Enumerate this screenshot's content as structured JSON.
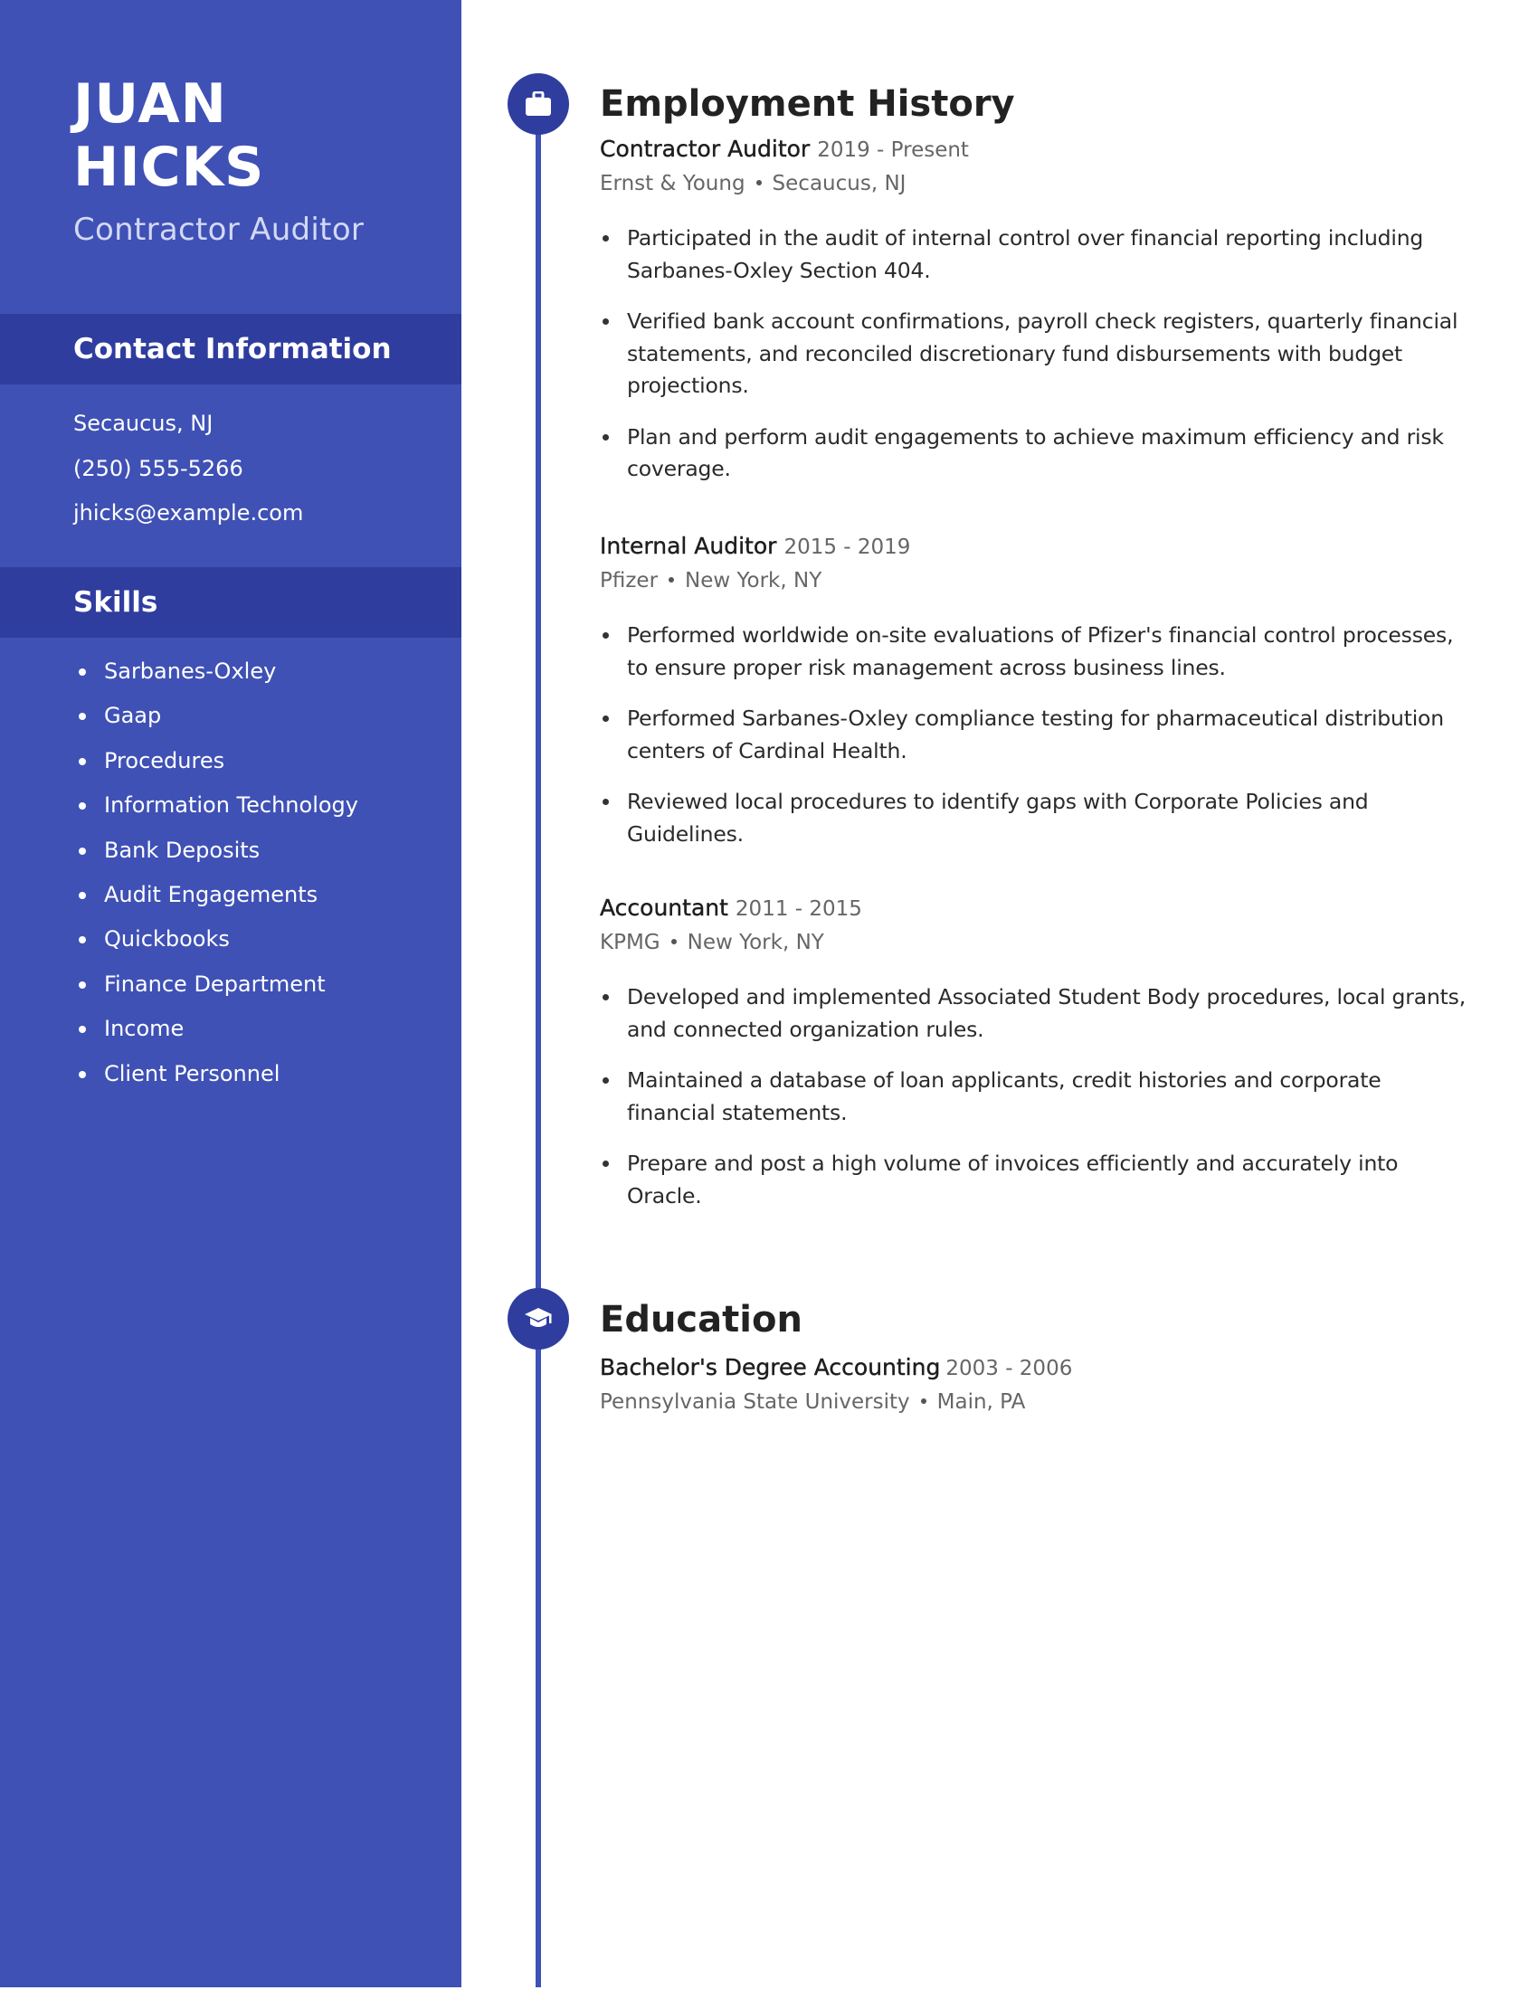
{
  "profile": {
    "first_name": "JUAN",
    "last_name": "HICKS",
    "headline": "Contractor Auditor"
  },
  "sidebar": {
    "contact": {
      "heading": "Contact Information",
      "location": "Secaucus, NJ",
      "phone": "(250) 555-5266",
      "email": "jhicks@example.com"
    },
    "skills": {
      "heading": "Skills",
      "items": [
        "Sarbanes-Oxley",
        "Gaap",
        "Procedures",
        "Information Technology",
        "Bank Deposits",
        "Audit Engagements",
        "Quickbooks",
        "Finance Department",
        "Income",
        "Client Personnel"
      ]
    }
  },
  "employment": {
    "heading": "Employment History",
    "icon": "briefcase-icon",
    "jobs": [
      {
        "title": "Contractor Auditor",
        "dates": "2019 - Present",
        "company": "Ernst & Young",
        "location": "Secaucus, NJ",
        "bullets": [
          "Participated in the audit of internal control over financial reporting including Sarbanes-Oxley Section 404.",
          "Verified bank account confirmations, payroll check registers, quarterly financial statements, and reconciled discretionary fund disbursements with budget projections.",
          "Plan and perform audit engagements to achieve maximum efficiency and risk coverage."
        ]
      },
      {
        "title": "Internal Auditor",
        "dates": "2015 - 2019",
        "company": "Pfizer",
        "location": "New York, NY",
        "bullets": [
          "Performed worldwide on-site evaluations of Pfizer's financial control processes, to ensure proper risk management across business lines.",
          "Performed Sarbanes-Oxley compliance testing for pharmaceutical distribution centers of Cardinal Health.",
          "Reviewed local procedures to identify gaps with Corporate Policies and Guidelines."
        ]
      },
      {
        "title": "Accountant",
        "dates": "2011 - 2015",
        "company": "KPMG",
        "location": "New York, NY",
        "bullets": [
          "Developed and implemented Associated Student Body procedures, local grants, and connected organization rules.",
          "Maintained a database of loan applicants, credit histories and corporate financial statements.",
          "Prepare and post a high volume of invoices efficiently and accurately into Oracle."
        ]
      }
    ]
  },
  "education": {
    "heading": "Education",
    "icon": "graduation-cap-icon",
    "entries": [
      {
        "degree": "Bachelor's Degree Accounting",
        "dates": "2003 - 2006",
        "school": "Pennsylvania State University",
        "location": "Main, PA"
      }
    ]
  },
  "colors": {
    "sidebar_bg": "#3f51b5",
    "sidebar_band": "#2f3d9f",
    "timeline": "#3f51b5",
    "heading_text": "#222222",
    "meta_text": "#666666"
  }
}
